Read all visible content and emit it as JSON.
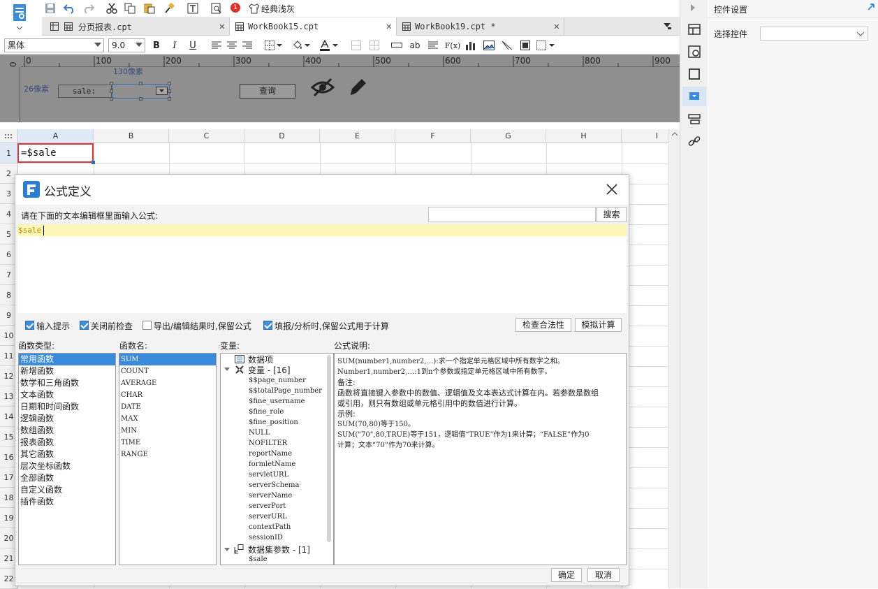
{
  "toolbar": {
    "classic_gray_label": "经典浅灰",
    "badge_count": "1"
  },
  "tabs": [
    {
      "label": "分页报表.cpt"
    },
    {
      "label": "WorkBook15.cpt"
    },
    {
      "label": "WorkBook19.cpt *"
    }
  ],
  "format_bar": {
    "font_name": "黑体",
    "font_size": "9.0",
    "bold": "B",
    "italic": "I",
    "underline": "U",
    "text_label": "ab",
    "formula_label": "F(x)"
  },
  "ruler": {
    "h_ticks": [
      "0",
      "100",
      "200",
      "300",
      "400",
      "500",
      "600",
      "700",
      "800",
      "900"
    ],
    "v_tick": "0"
  },
  "param_pane": {
    "width_hint": "130像素",
    "height_hint": "26像素",
    "label_text": "sale:",
    "query_button": "查询"
  },
  "sheet": {
    "columns": [
      "A",
      "B",
      "C",
      "D",
      "E",
      "F",
      "G",
      "H",
      "I"
    ],
    "rows": [
      "1",
      "2",
      "3",
      "4",
      "5",
      "6",
      "7",
      "8",
      "9",
      "10",
      "11",
      "12",
      "13",
      "14",
      "15",
      "16",
      "17",
      "18",
      "19",
      "20",
      "21",
      "22"
    ],
    "a1_value": "=$sale"
  },
  "right_panel": {
    "title": "控件设置",
    "select_label": "选择控件",
    "select_value": ""
  },
  "dialog": {
    "title": "公式定义",
    "prompt": "请在下面的文本编辑框里面输入公式:",
    "search_value": "",
    "search_button": "搜索",
    "formula_text": "$sale",
    "options": [
      {
        "label": "输入提示",
        "checked": true
      },
      {
        "label": "关闭前检查",
        "checked": true
      },
      {
        "label": "导出/编辑结果时,保留公式",
        "checked": false
      },
      {
        "label": "填报/分析时,保留公式用于计算",
        "checked": true
      }
    ],
    "check_validity_button": "检查合法性",
    "simulate_button": "模拟计算",
    "function_type_header": "函数类型:",
    "function_types": [
      "常用函数",
      "新增函数",
      "数学和三角函数",
      "文本函数",
      "日期和时间函数",
      "逻辑函数",
      "数组函数",
      "报表函数",
      "其它函数",
      "层次坐标函数",
      "全部函数",
      "自定义函数",
      "插件函数"
    ],
    "function_name_header": "函数名:",
    "function_names": [
      "SUM",
      "COUNT",
      "AVERAGE",
      "CHAR",
      "DATE",
      "MAX",
      "MIN",
      "TIME",
      "RANGE"
    ],
    "variable_header": "变量:",
    "tree": {
      "data_item": "数据项",
      "variables_node": "变量 - [16]",
      "variables": [
        "$$page_number",
        "$$totalPage_number",
        "$fine_username",
        "$fine_role",
        "$fine_position",
        "NULL",
        "NOFILTER",
        "reportName",
        "formletName",
        "servletURL",
        "serverSchema",
        "serverName",
        "serverPort",
        "serverURL",
        "contextPath",
        "sessionID"
      ],
      "dataset_params_node": "数据集参数 - [1]",
      "dataset_params": [
        "$sale"
      ]
    },
    "description_header": "公式说明:",
    "description_lines": [
      "SUM(number1,number2,…):求一个指定单元格区域中所有数字之和。",
      "Number1,number2,…:1到n个参数或指定单元格区域中所有数字。",
      "备注:",
      "函数将直接键入参数中的数值、逻辑值及文本表达式计算在内。若参数是数组",
      "或引用，则只有数组或单元格引用中的数值进行计算。",
      "示例:",
      "SUM(70,80)等于150。",
      "SUM(\"70\",80,TRUE)等于151，逻辑值“TRUE”作为1来计算；“FALSE”作为0",
      "计算；文本“70”作为70来计算。"
    ],
    "ok_button": "确定",
    "cancel_button": "取消"
  }
}
